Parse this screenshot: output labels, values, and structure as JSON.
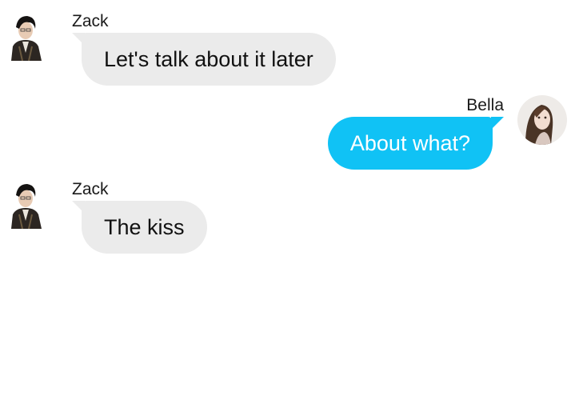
{
  "messages": [
    {
      "sender": "Zack",
      "text": "Let's talk about it later",
      "side": "left"
    },
    {
      "sender": "Bella",
      "text": "About what?",
      "side": "right"
    },
    {
      "sender": "Zack",
      "text": "The kiss",
      "side": "left"
    }
  ],
  "colors": {
    "incoming_bubble": "#ebebeb",
    "outgoing_bubble": "#10c2f5",
    "outgoing_text": "#ffffff"
  }
}
